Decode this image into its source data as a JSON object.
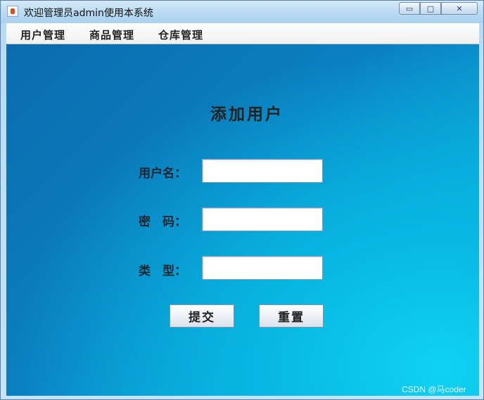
{
  "window": {
    "title": "欢迎管理员admin使用本系统"
  },
  "window_controls": {
    "minimize": "▭",
    "maximize": "□",
    "close": "✕"
  },
  "menubar": {
    "items": [
      "用户管理",
      "商品管理",
      "仓库管理"
    ]
  },
  "form": {
    "title": "添加用户",
    "username_label": "用户名：",
    "password_label": "密　码：",
    "type_label": "类　型：",
    "username_value": "",
    "password_value": "",
    "type_value": "",
    "submit_label": "提交",
    "reset_label": "重置"
  },
  "watermark": "CSDN @马coder",
  "icons": {
    "app": "java-app-icon"
  }
}
